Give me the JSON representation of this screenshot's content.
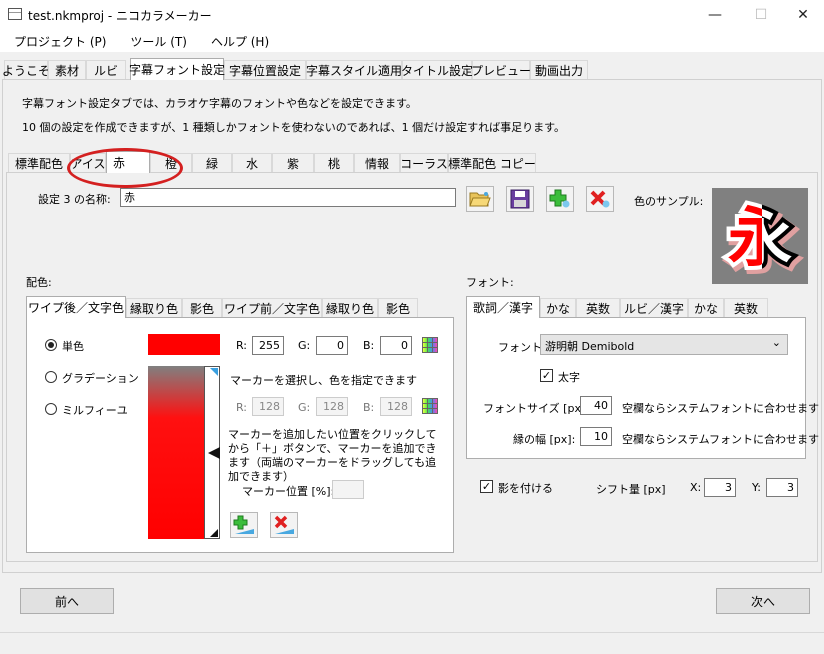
{
  "window": {
    "title": "test.nkmproj - ニコカラメーカー",
    "minimize": "—",
    "maximize": "☐",
    "close": "✕"
  },
  "menu": [
    "プロジェクト (P)",
    "ツール (T)",
    "ヘルプ (H)"
  ],
  "main_tabs": [
    "ようこそ",
    "素材",
    "ルビ",
    "字幕フォント設定",
    "字幕位置設定",
    "字幕スタイル適用",
    "タイトル設定",
    "プレビュー",
    "動画出力"
  ],
  "active_main_tab": "字幕フォント設定",
  "description": {
    "line1": "字幕フォント設定タブでは、カラオケ字幕のフォントや色などを設定できます。",
    "line2": "10 個の設定を作成できますが、1 種類しかフォントを使わないのであれば、1 個だけ設定すれば事足ります。"
  },
  "setting_tabs": [
    "標準配色",
    "アイス",
    "赤",
    "橙",
    "緑",
    "水",
    "紫",
    "桃",
    "情報",
    "コーラス",
    "標準配色 コピー"
  ],
  "active_setting_tab": "赤",
  "name_row": {
    "label": "設定 3 の名称:",
    "value": "赤",
    "color_sample_label": "色のサンプル:",
    "sample_glyph": "永"
  },
  "toolbar_icons": [
    "open-folder-icon",
    "save-disk-icon",
    "add-icon",
    "delete-icon"
  ],
  "color_section": {
    "label": "配色:",
    "tabs": [
      "ワイプ後／文字色",
      "縁取り色",
      "影色",
      "ワイプ前／文字色",
      "縁取り色",
      "影色"
    ],
    "radio_single": "単色",
    "radio_gradient": "グラデーション",
    "radio_mille": "ミルフィーユ",
    "single_color": "#ff0000",
    "r_label": "R:",
    "g_label": "G:",
    "b_label": "B:",
    "r": "255",
    "g": "0",
    "b": "0",
    "marker_hint": "マーカーを選択し、色を指定できます",
    "marker_r": "128",
    "marker_g": "128",
    "marker_b": "128",
    "add_hint": "マーカーを追加したい位置をクリックしてから「＋」ボタンで、マーカーを追加できます（両端のマーカーをドラッグしても追加できます）",
    "marker_pos_label": "マーカー位置 [%]:",
    "marker_pos_value": ""
  },
  "font_section": {
    "label": "フォント:",
    "tabs": [
      "歌詞／漢字",
      "かな",
      "英数",
      "ルビ／漢字",
      "かな",
      "英数"
    ],
    "font_label": "フォント:",
    "font_value": "游明朝 Demibold",
    "bold_label": "太字",
    "bold_checked": true,
    "size_label": "フォントサイズ [px]:",
    "size_value": "40",
    "size_hint": "空欄ならシステムフォントに合わせます",
    "edge_label": "縁の幅 [px]:",
    "edge_value": "10",
    "edge_hint": "空欄ならシステムフォントに合わせます"
  },
  "shadow": {
    "label": "影を付ける",
    "checked": true,
    "shift_label": "シフト量 [px]",
    "x_label": "X:",
    "x": "3",
    "y_label": "Y:",
    "y": "3"
  },
  "nav": {
    "prev": "前へ",
    "next": "次へ"
  },
  "colors": {
    "red": "#ff0000",
    "annotation": "#d42020"
  }
}
